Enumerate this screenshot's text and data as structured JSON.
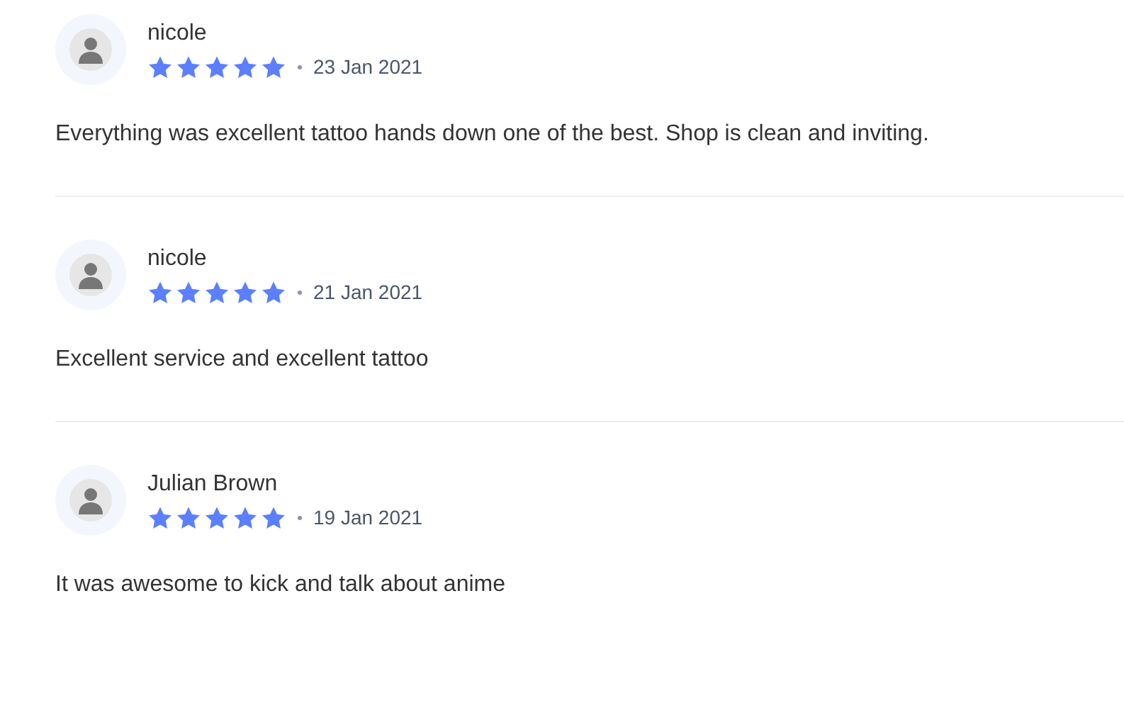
{
  "reviews": [
    {
      "author": "nicole",
      "stars": 5,
      "date": "23 Jan 2021",
      "text": "Everything was excellent tattoo hands down one of the best. Shop is clean and inviting."
    },
    {
      "author": "nicole",
      "stars": 5,
      "date": "21 Jan 2021",
      "text": "Excellent service and excellent tattoo"
    },
    {
      "author": "Julian Brown",
      "stars": 5,
      "date": "19 Jan 2021",
      "text": "It was awesome to kick and talk about anime"
    }
  ]
}
